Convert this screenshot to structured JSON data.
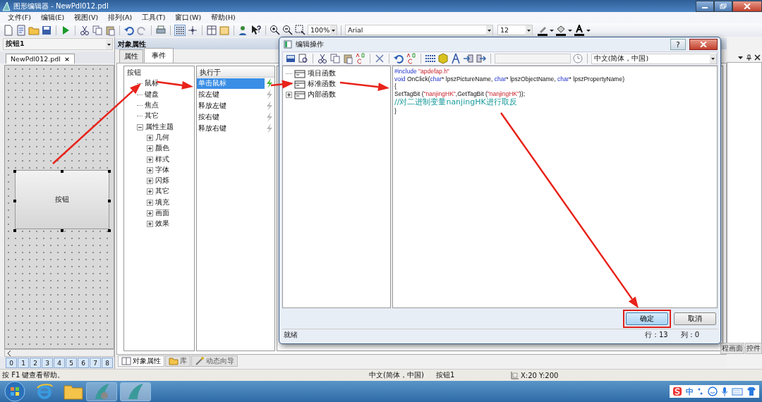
{
  "window": {
    "title": "图形编辑器 - NewPdl012.pdl"
  },
  "menu": [
    "文件(F)",
    "编辑(E)",
    "视图(V)",
    "排列(A)",
    "工具(T)",
    "窗口(W)",
    "帮助(H)"
  ],
  "toolbar": {
    "zoom": "100%",
    "font": "Arial",
    "font_size": "12"
  },
  "object_combo": "按钮1",
  "document_tab": {
    "label": "NewPdl012.pdl",
    "close": "×"
  },
  "canvas": {
    "button_label": "按钮",
    "selected": true
  },
  "layer_tabs": [
    "0",
    "1",
    "2",
    "3",
    "4",
    "5",
    "6",
    "7",
    "8"
  ],
  "properties_panel": {
    "title": "对象属性",
    "tabs": [
      {
        "label": "属性",
        "selected": false
      },
      {
        "label": "事件",
        "selected": true
      }
    ],
    "tree": [
      {
        "label": "按钮",
        "children": [
          {
            "label": "鼠标"
          },
          {
            "label": "键盘"
          },
          {
            "label": "焦点"
          },
          {
            "label": "其它"
          },
          {
            "label": "属性主题",
            "expanded": true,
            "children": [
              {
                "label": "几何",
                "expanded": false
              },
              {
                "label": "颜色",
                "expanded": false
              },
              {
                "label": "样式",
                "expanded": false
              },
              {
                "label": "字体",
                "expanded": false
              },
              {
                "label": "闪烁",
                "expanded": false
              },
              {
                "label": "其它",
                "expanded": false
              },
              {
                "label": "填充",
                "expanded": false
              },
              {
                "label": "画面",
                "expanded": false
              },
              {
                "label": "效果",
                "expanded": false
              }
            ]
          }
        ]
      }
    ],
    "events_header": "执行于",
    "events": [
      {
        "label": "单击鼠标",
        "selected": true,
        "configured": true
      },
      {
        "label": "按左键",
        "selected": false,
        "configured": false
      },
      {
        "label": "释放左键",
        "selected": false,
        "configured": false
      },
      {
        "label": "按右键",
        "selected": false,
        "configured": false
      },
      {
        "label": "释放右键",
        "selected": false,
        "configured": false
      }
    ],
    "bottom_tabs": [
      {
        "label": "对象属性",
        "selected": true
      },
      {
        "label": "库",
        "selected": false
      },
      {
        "label": "动态向导",
        "selected": false
      }
    ]
  },
  "right_panel": {
    "tabs": [
      "程画面",
      "控件"
    ]
  },
  "dialog": {
    "title": "编辑操作",
    "help": "?",
    "language": "中文(简体，中国)",
    "function_tree": [
      {
        "label": "项目函数"
      },
      {
        "label": "标准函数"
      },
      {
        "label": "内部函数",
        "expanded": false
      }
    ],
    "code": [
      [
        {
          "text": "#include ",
          "kind": "keyword"
        },
        {
          "text": "\"apdefap.h\"",
          "kind": "string"
        }
      ],
      [
        {
          "text": "void ",
          "kind": "keyword"
        },
        {
          "text": "OnClick(",
          "kind": "plain"
        },
        {
          "text": "char",
          "kind": "keyword"
        },
        {
          "text": "* lpszPictureName, ",
          "kind": "plain"
        },
        {
          "text": "char",
          "kind": "keyword"
        },
        {
          "text": "* lpszObjectName, ",
          "kind": "plain"
        },
        {
          "text": "char",
          "kind": "keyword"
        },
        {
          "text": "* lpszPropertyName)",
          "kind": "plain"
        }
      ],
      [
        {
          "text": "{",
          "kind": "plain"
        }
      ],
      [
        {
          "text": "SetTagBit (",
          "kind": "plain"
        },
        {
          "text": "\"nanjingHK\"",
          "kind": "string"
        },
        {
          "text": ",GetTagBit (",
          "kind": "plain"
        },
        {
          "text": "\"nanjingHK\"",
          "kind": "string"
        },
        {
          "text": "));",
          "kind": "plain"
        }
      ],
      [
        {
          "text": "//对二进制变量nanjingHK进行取反",
          "kind": "comment"
        }
      ],
      [
        {
          "text": "}",
          "kind": "plain"
        }
      ]
    ],
    "buttons": [
      {
        "label": "确定",
        "highlighted": true
      },
      {
        "label": "取消",
        "highlighted": false
      }
    ],
    "status": "就绪",
    "row": "行：13",
    "column": "列：0"
  },
  "status_bar": {
    "help": "按 F1 键查看帮助。",
    "language": "中文(简体，中国)",
    "object": "按钮1",
    "position": "X:20 Y:200"
  },
  "tray": {
    "ime": "中"
  }
}
